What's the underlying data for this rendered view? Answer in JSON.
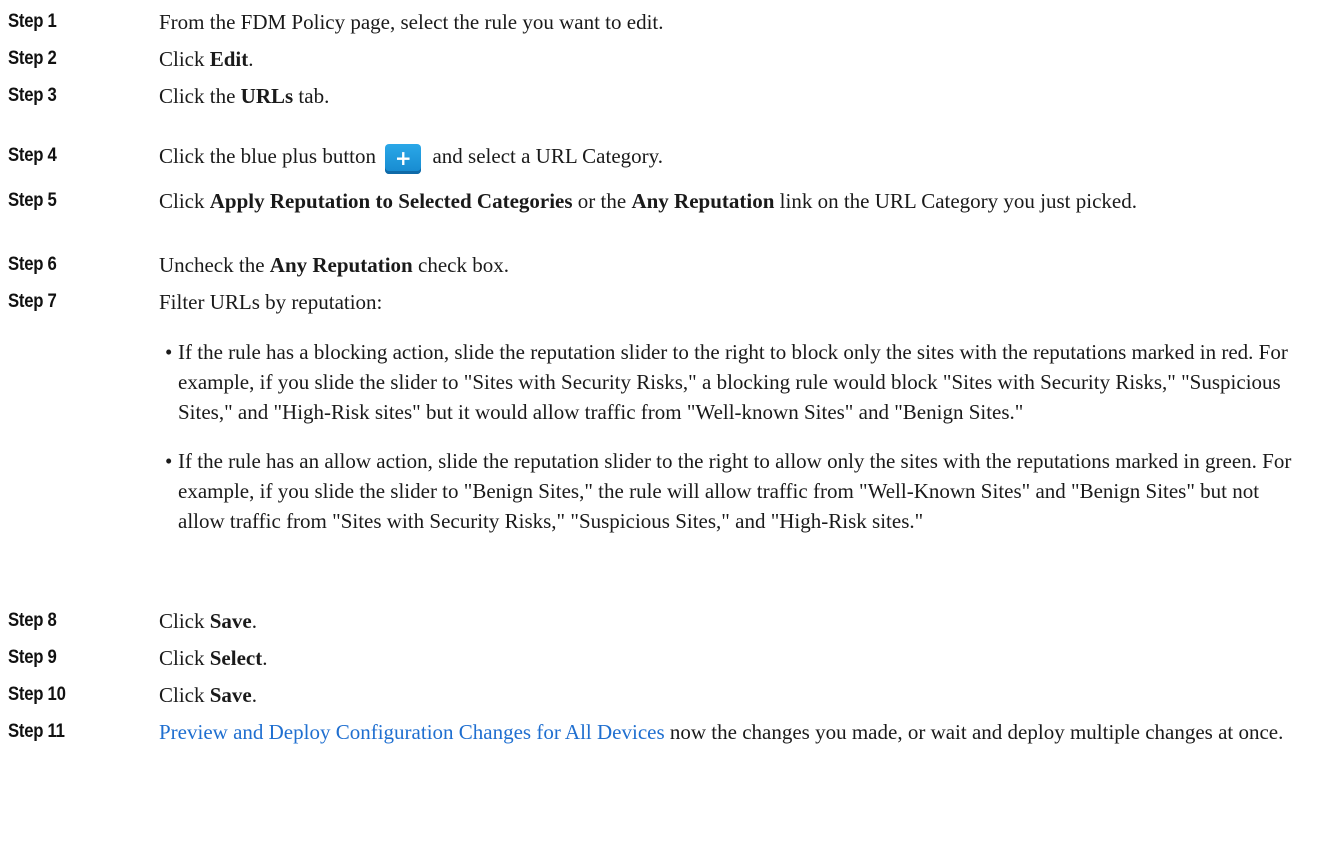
{
  "steps": [
    {
      "label": "Step 1",
      "text": "From the FDM Policy page, select the rule you want to edit."
    },
    {
      "label": "Step 2",
      "pre": "Click ",
      "bold": "Edit",
      "post": "."
    },
    {
      "label": "Step 3",
      "pre": "Click the ",
      "bold": "URLs",
      "post": " tab."
    },
    {
      "label": "Step 4",
      "pre": "Click the blue plus button",
      "button_glyph": "+",
      "button_icon": "plus-icon",
      "post": "and select a URL Category."
    },
    {
      "label": "Step 5",
      "pre": "Click ",
      "bold1": "Apply Reputation to Selected Categories",
      "mid": " or the ",
      "bold2": "Any Reputation",
      "post": " link on the URL Category you just picked."
    },
    {
      "label": "Step 6",
      "pre": "Uncheck the ",
      "bold": "Any Reputation",
      "post": " check box."
    },
    {
      "label": "Step 7",
      "text": "Filter URLs by reputation:"
    },
    {
      "label": "Step 8",
      "pre": "Click ",
      "bold": "Save",
      "post": "."
    },
    {
      "label": "Step 9",
      "pre": "Click ",
      "bold": "Select",
      "post": "."
    },
    {
      "label": "Step 10",
      "pre": "Click ",
      "bold": "Save",
      "post": "."
    },
    {
      "label": "Step 11",
      "link": "Preview and Deploy Configuration Changes for All Devices",
      "post": " now the changes you made, or wait and deploy multiple changes at once."
    }
  ],
  "step7_bullets": [
    {
      "marker": "•",
      "text": "If the rule has a blocking action, slide the reputation slider to the right to block only the sites with the reputations marked in red. For example, if you slide the slider to \"Sites with Security Risks,\" a blocking rule would block \"Sites with Security Risks,\" \"Suspicious Sites,\" and \"High-Risk sites\" but it would allow traffic from \"Well-known Sites\" and \"Benign Sites.\""
    },
    {
      "marker": "•",
      "text": "If the rule has an allow action, slide the reputation slider to the right to allow only the sites with the reputations marked in green. For example, if you slide the slider to \"Benign Sites,\" the rule will allow traffic from \"Well-Known Sites\" and \"Benign Sites\" but not allow traffic from \"Sites with Security Risks,\" \"Suspicious Sites,\" and \"High-Risk sites.\""
    }
  ],
  "colors": {
    "link": "#1f6fd0",
    "button": "#1689cf",
    "text": "#1a1a1a"
  }
}
